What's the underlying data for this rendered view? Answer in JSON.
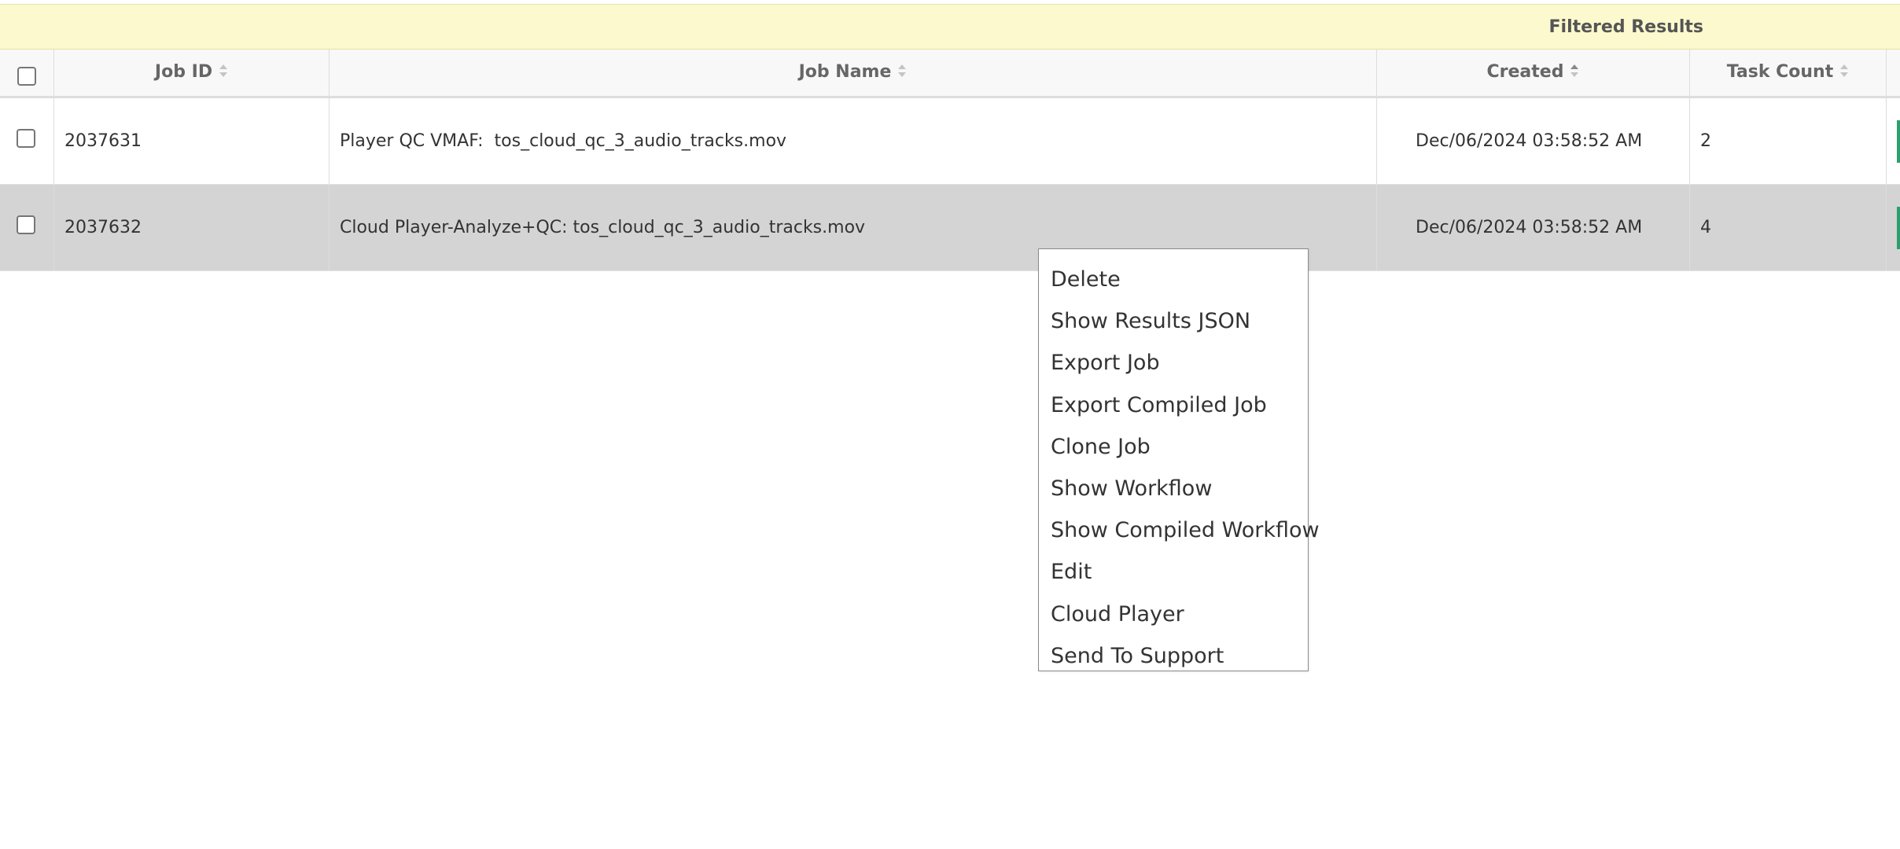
{
  "banner": {
    "title": "Filtered Results"
  },
  "table": {
    "columns": [
      {
        "key": "job_id",
        "label": "Job ID",
        "sortable": true
      },
      {
        "key": "job_name",
        "label": "Job Name",
        "sortable": true
      },
      {
        "key": "created",
        "label": "Created",
        "sortable": true,
        "sorted": "asc"
      },
      {
        "key": "task_count",
        "label": "Task Count",
        "sortable": true
      }
    ],
    "rows": [
      {
        "job_id": "2037631",
        "job_name": "Player QC VMAF:  tos_cloud_qc_3_audio_tracks.mov",
        "created": "Dec/06/2024 03:58:52 AM",
        "task_count": "2",
        "selected": false,
        "highlighted": false
      },
      {
        "job_id": "2037632",
        "job_name": "Cloud Player-Analyze+QC: tos_cloud_qc_3_audio_tracks.mov",
        "created": "Dec/06/2024 03:58:52 AM",
        "task_count": "4",
        "selected": false,
        "highlighted": true
      }
    ]
  },
  "context_menu": {
    "items": [
      "Delete",
      "Show Results JSON",
      "Export Job",
      "Export Compiled Job",
      "Clone Job",
      "Show Workflow",
      "Show Compiled Workflow",
      "Edit",
      "Cloud Player",
      "Send To Support"
    ]
  },
  "colors": {
    "banner_bg": "#fbf9cd",
    "highlight_row_bg": "#d4d4d4",
    "status_accent": "#2e9e6e"
  }
}
